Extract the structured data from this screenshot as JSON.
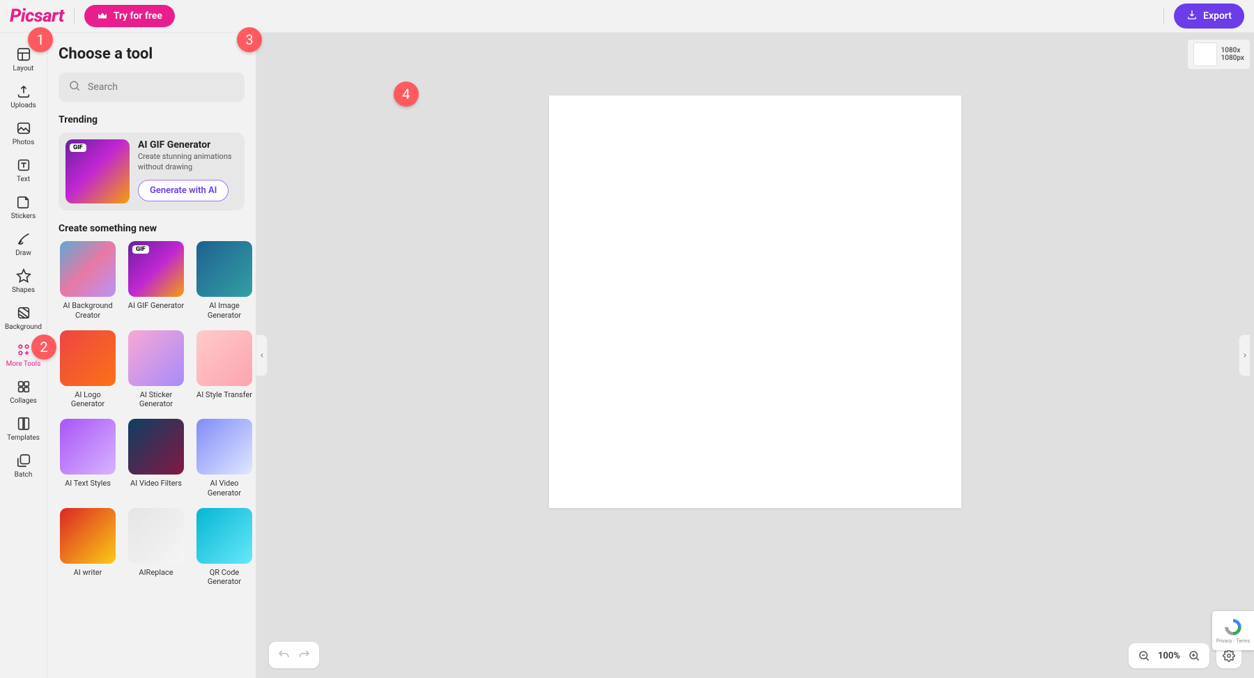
{
  "header": {
    "logo_text": "Picsart",
    "try_free_label": "Try for free",
    "export_label": "Export"
  },
  "sidebar": {
    "items": [
      {
        "label": "Layout",
        "icon": "layout-icon"
      },
      {
        "label": "Uploads",
        "icon": "upload-icon"
      },
      {
        "label": "Photos",
        "icon": "photo-icon"
      },
      {
        "label": "Text",
        "icon": "text-icon"
      },
      {
        "label": "Stickers",
        "icon": "sticker-icon"
      },
      {
        "label": "Draw",
        "icon": "brush-icon"
      },
      {
        "label": "Shapes",
        "icon": "star-icon"
      },
      {
        "label": "Background",
        "icon": "pattern-icon"
      },
      {
        "label": "More Tools",
        "icon": "apps-icon",
        "active": true
      },
      {
        "label": "Collages",
        "icon": "grid-icon"
      },
      {
        "label": "Templates",
        "icon": "book-icon"
      },
      {
        "label": "Batch",
        "icon": "stack-icon"
      }
    ]
  },
  "panel": {
    "title": "Choose a tool",
    "search_placeholder": "Search",
    "trending_heading": "Trending",
    "trending_card": {
      "badge": "GIF",
      "title": "AI GIF Generator",
      "desc": "Create stunning animations without drawing",
      "button": "Generate with AI"
    },
    "create_heading": "Create something new",
    "tools": [
      {
        "label": "AI Background Creator",
        "bg": "linear-gradient(135deg,#5fa8d3,#e879a5,#b794f6)"
      },
      {
        "label": "AI GIF Generator",
        "bg": "linear-gradient(135deg,#6b1f9e,#c026d3,#f59e0b)",
        "badge": "GIF"
      },
      {
        "label": "AI Image Generator",
        "bg": "linear-gradient(135deg,#1e6091,#34a0a4)"
      },
      {
        "label": "AI Logo Generator",
        "bg": "linear-gradient(135deg,#ef4444,#f97316)"
      },
      {
        "label": "AI Sticker Generator",
        "bg": "linear-gradient(135deg,#f9a8d4,#a78bfa)"
      },
      {
        "label": "AI Style Transfer",
        "bg": "linear-gradient(135deg,#fecaca,#fda4af)"
      },
      {
        "label": "AI Text Styles",
        "bg": "linear-gradient(135deg,#a855f7,#d8b4fe)"
      },
      {
        "label": "AI Video Filters",
        "bg": "linear-gradient(135deg,#0e3e62,#831843)"
      },
      {
        "label": "AI Video Generator",
        "bg": "linear-gradient(135deg,#818cf8,#e0e7ff)"
      },
      {
        "label": "AI writer",
        "bg": "linear-gradient(135deg,#dc2626,#facc15)"
      },
      {
        "label": "AIReplace",
        "bg": "linear-gradient(135deg,#e5e5e5,#f5f5f5)"
      },
      {
        "label": "QR Code Generator",
        "bg": "linear-gradient(135deg,#06b6d4,#67e8f9)"
      }
    ]
  },
  "canvas": {
    "width_label": "1080x",
    "height_label": "1080px"
  },
  "zoom": {
    "percent": "100%"
  },
  "markers": {
    "m1": "1",
    "m2": "2",
    "m3": "3",
    "m4": "4"
  },
  "recaptcha": {
    "privacy": "Privacy",
    "terms": "Terms"
  }
}
